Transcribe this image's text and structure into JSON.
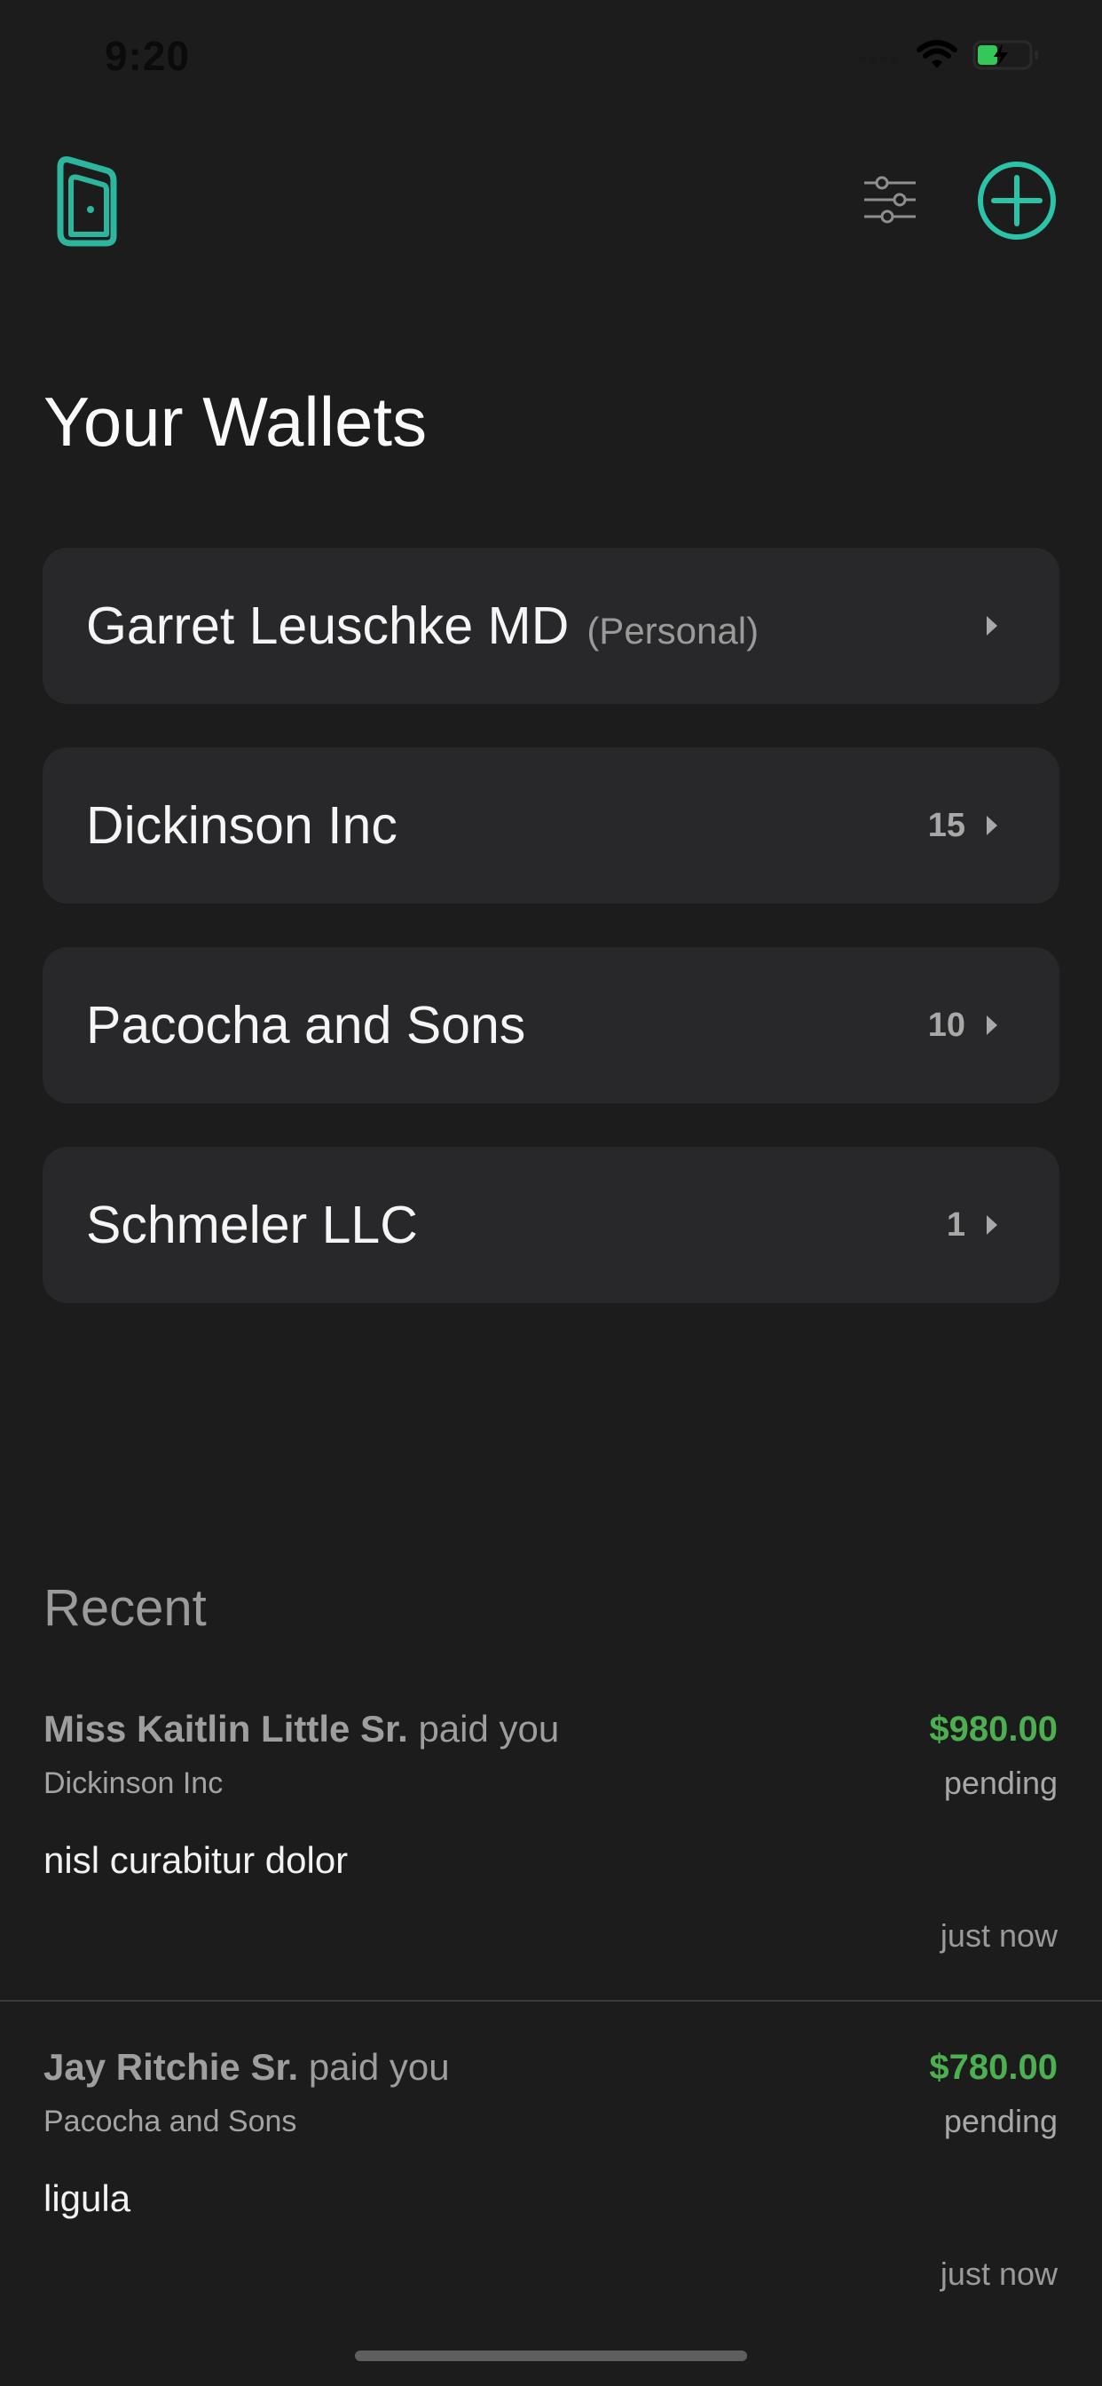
{
  "status_bar": {
    "time": "9:20",
    "icons": [
      "cellular-icon",
      "wifi-icon",
      "battery-charging-icon"
    ],
    "battery_color": "#34c759"
  },
  "header": {
    "logo_icon": "wallet-door-icon",
    "filter_icon": "sliders-icon",
    "add_icon": "plus-circle-icon",
    "accent_color": "#2bc4a8"
  },
  "page_title": "Your Wallets",
  "wallets": [
    {
      "name": "Garret Leuschke MD",
      "tag": "(Personal)",
      "count": ""
    },
    {
      "name": "Dickinson Inc",
      "tag": "",
      "count": "15"
    },
    {
      "name": "Pacocha and Sons",
      "tag": "",
      "count": "10"
    },
    {
      "name": "Schmeler LLC",
      "tag": "",
      "count": "1"
    }
  ],
  "recent": {
    "title": "Recent",
    "items": [
      {
        "payer": "Miss Kaitlin Little Sr.",
        "verb": "paid you",
        "wallet": "Dickinson Inc",
        "memo": "nisl curabitur dolor",
        "amount": "$980.00",
        "status": "pending",
        "time": "just now"
      },
      {
        "payer": "Jay Ritchie Sr.",
        "verb": "paid you",
        "wallet": "Pacocha and Sons",
        "memo": "ligula",
        "amount": "$780.00",
        "status": "pending",
        "time": "just now"
      }
    ]
  }
}
